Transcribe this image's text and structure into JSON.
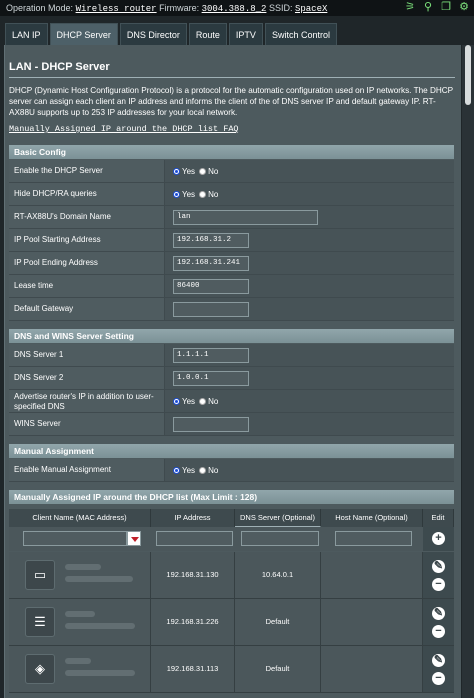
{
  "topbar": {
    "operation_mode_label": "Operation Mode:",
    "operation_mode_value": "Wireless router",
    "firmware_label": "Firmware:",
    "firmware_value": "3004.388.8_2",
    "ssid_label": "SSID:",
    "ssid_value": "SpaceX",
    "icons": [
      "wifi-icon",
      "usb-icon",
      "copy-icon",
      "settings-icon"
    ]
  },
  "tabs": [
    {
      "label": "LAN IP"
    },
    {
      "label": "DHCP Server",
      "active": true
    },
    {
      "label": "DNS Director"
    },
    {
      "label": "Route"
    },
    {
      "label": "IPTV"
    },
    {
      "label": "Switch Control"
    }
  ],
  "page": {
    "title": "LAN - DHCP Server",
    "description": "DHCP (Dynamic Host Configuration Protocol) is a protocol for the automatic configuration used on IP networks. The DHCP server can assign each client an IP address and informs the client of the of DNS server IP and default gateway IP. RT-AX88U supports up to 253 IP addresses for your local network.",
    "faq_link": "Manually Assigned IP around the DHCP list FAQ"
  },
  "basic_config": {
    "header": "Basic Config",
    "enable_dhcp_label": "Enable the DHCP Server",
    "hide_dhcp_label": "Hide DHCP/RA queries",
    "domain_label": "RT-AX88U's Domain Name",
    "domain_value": "lan",
    "pool_start_label": "IP Pool Starting Address",
    "pool_start_value": "192.168.31.2",
    "pool_end_label": "IP Pool Ending Address",
    "pool_end_value": "192.168.31.241",
    "lease_label": "Lease time",
    "lease_value": "86400",
    "gateway_label": "Default Gateway",
    "gateway_value": ""
  },
  "radio": {
    "yes": "Yes",
    "no": "No"
  },
  "dns_wins": {
    "header": "DNS and WINS Server Setting",
    "dns1_label": "DNS Server 1",
    "dns1_value": "1.1.1.1",
    "dns2_label": "DNS Server 2",
    "dns2_value": "1.0.0.1",
    "advertise_label": "Advertise router's IP in addition to user-specified DNS",
    "wins_label": "WINS Server",
    "wins_value": ""
  },
  "manual": {
    "header": "Manual Assignment",
    "enable_label": "Enable Manual Assignment"
  },
  "manual_list": {
    "header": "Manually Assigned IP around the DHCP list (Max Limit : 128)",
    "columns": [
      "Client Name (MAC Address)",
      "IP Address",
      "DNS Server (Optional)",
      "Host Name (Optional)",
      "Edit"
    ],
    "rows": [
      {
        "icon": "laptop-icon",
        "ip": "192.168.31.130",
        "dns": "10.64.0.1",
        "host": ""
      },
      {
        "icon": "router-icon",
        "ip": "192.168.31.226",
        "dns": "Default",
        "host": ""
      },
      {
        "icon": "playstation-icon",
        "ip": "192.168.31.113",
        "dns": "Default",
        "host": ""
      }
    ]
  }
}
